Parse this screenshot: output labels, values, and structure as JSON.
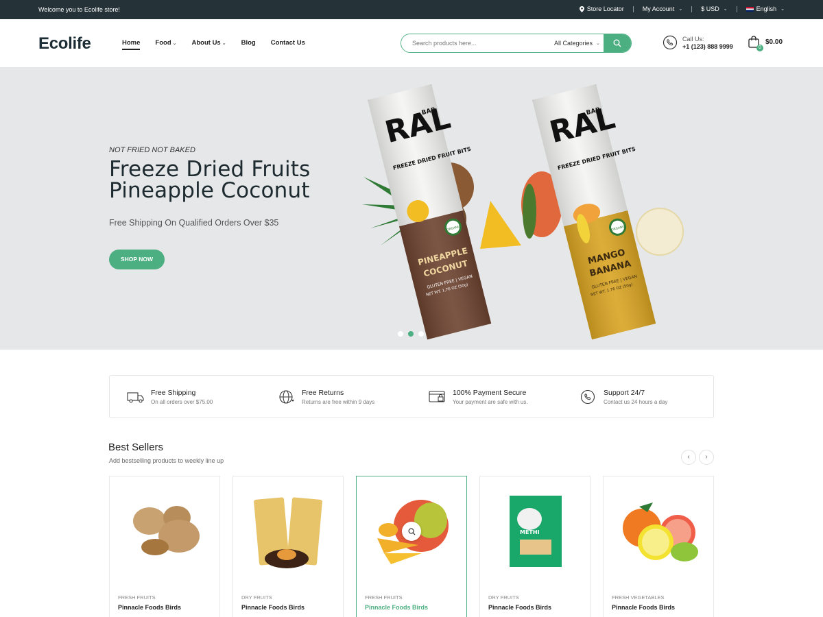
{
  "topbar": {
    "welcome": "Welcome you to Ecolife store!",
    "store_locator": "Store Locator",
    "account": "My Account",
    "currency": "$ USD",
    "language": "English"
  },
  "header": {
    "logo": "Ecolife",
    "nav": [
      {
        "label": "Home",
        "dropdown": false,
        "active": true
      },
      {
        "label": "Food",
        "dropdown": true
      },
      {
        "label": "About Us",
        "dropdown": true
      },
      {
        "label": "Blog",
        "dropdown": false
      },
      {
        "label": "Contact Us",
        "dropdown": false
      }
    ],
    "search_placeholder": "Search products here...",
    "search_category": "All Categories",
    "call_label": "Call Us:",
    "call_number": "+1 (123) 888 9999",
    "cart_count": "0",
    "cart_total": "$0.00"
  },
  "hero": {
    "eyebrow": "NOT FRIED NOT BAKED",
    "title_line1": "Freeze Dried Fruits",
    "title_line2": "Pineapple Coconut",
    "subtitle": "Free Shipping On Qualified Orders Over $35",
    "cta": "SHOP NOW",
    "active_slide": 2,
    "slide_count": 3,
    "product1": {
      "brand": "RAL",
      "bar": "BAR",
      "desc": "FREEZE DRIED FRUIT BITS",
      "flavor1": "PINEAPPLE",
      "flavor2": "COCONUT",
      "badge": "ORGANIC",
      "info": "GLUTEN FREE | VEGAN",
      "wt": "NET WT. 1.76 OZ (50g)"
    },
    "product2": {
      "brand": "RAL",
      "bar": "BAR",
      "desc": "FREEZE DRIED FRUIT BITS",
      "flavor1": "MANGO",
      "flavor2": "BANANA",
      "badge": "ORGANIC",
      "info": "GLUTEN FREE | VEGAN",
      "wt": "NET WT. 1.76 OZ (50g)"
    }
  },
  "features": [
    {
      "title": "Free Shipping",
      "sub": "On all orders over $75.00",
      "icon": "truck-icon"
    },
    {
      "title": "Free Returns",
      "sub": "Returns are free within 9 days",
      "icon": "globe-icon"
    },
    {
      "title": "100% Payment Secure",
      "sub": "Your payment are safe with us.",
      "icon": "payment-icon"
    },
    {
      "title": "Support 24/7",
      "sub": "Contact us 24 hours a day",
      "icon": "phone-support-icon"
    }
  ],
  "best_sellers": {
    "title": "Best Sellers",
    "subtitle": "Add bestselling products to weekly line up",
    "products": [
      {
        "category": "FRESH FRUITS",
        "name": "Pinnacle Foods Birds",
        "image": "walnuts"
      },
      {
        "category": "DRY FRUITS",
        "name": "Pinnacle Foods Birds",
        "image": "apricot-snack"
      },
      {
        "category": "FRESH FRUITS",
        "name": "Pinnacle Foods Birds",
        "image": "mango",
        "hovered": true
      },
      {
        "category": "DRY FRUITS",
        "name": "Pinnacle Foods Birds",
        "image": "methi-box",
        "pkg_text": "METHI"
      },
      {
        "category": "FRESH VEGETABLES",
        "name": "Pinnacle Foods Birds",
        "image": "citrus"
      }
    ]
  },
  "colors": {
    "accent": "#4caf81",
    "topbar": "#253237",
    "hero_bg": "#e5e7e8"
  }
}
